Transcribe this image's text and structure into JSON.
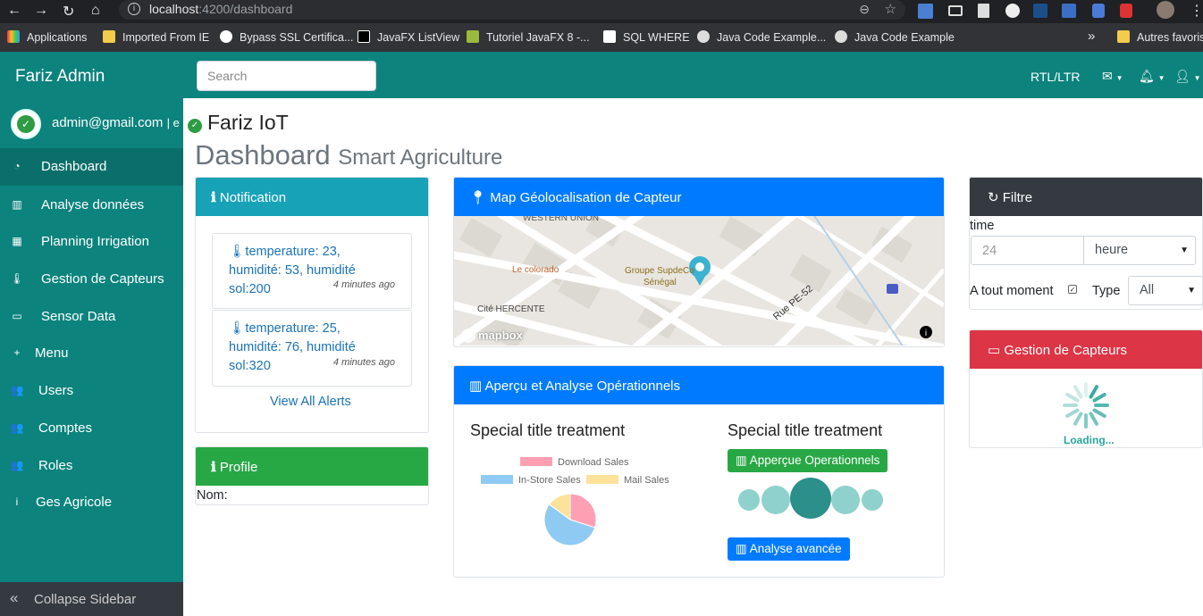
{
  "browser": {
    "url_host": "localhost",
    "url_path": ":4200/dashboard",
    "bookmarks": [
      "Applications",
      "Imported From IE",
      "Bypass SSL Certifica...",
      "JavaFX ListView",
      "Tutoriel JavaFX 8 -...",
      "SQL WHERE",
      "Java Code Example...",
      "Java Code Example",
      "»",
      "Autres favoris"
    ]
  },
  "topnav": {
    "brand": "Fariz Admin",
    "search_placeholder": "Search",
    "rtl_label": "RTL/LTR"
  },
  "sidebar": {
    "email": "admin@gmail.com",
    "email_suffix": "| e",
    "items": [
      {
        "label": "Dashboard",
        "icon": "dashboard-icon",
        "glyph": "◔"
      },
      {
        "label": "Analyse données",
        "icon": "bar-chart-icon",
        "glyph": "▥"
      },
      {
        "label": "Planning Irrigation",
        "icon": "table-icon",
        "glyph": "▦"
      },
      {
        "label": "Gestion de Capteurs",
        "icon": "thermometer-icon",
        "glyph": "🌡"
      },
      {
        "label": "Sensor Data",
        "icon": "laptop-icon",
        "glyph": "▭"
      },
      {
        "label": "Menu",
        "icon": "plus-icon",
        "glyph": "+"
      },
      {
        "label": "Users",
        "icon": "users-icon",
        "glyph": "👥"
      },
      {
        "label": "Comptes",
        "icon": "users-icon",
        "glyph": "👥"
      },
      {
        "label": "Roles",
        "icon": "users-icon",
        "glyph": "👥"
      },
      {
        "label": "Ges Agricole",
        "icon": "info-icon",
        "glyph": "i"
      }
    ],
    "collapse_label": "Collapse Sidebar"
  },
  "header": {
    "title": "Fariz IoT",
    "dashboard": "Dashboard",
    "subtitle": "Smart Agriculture"
  },
  "notification": {
    "title": "Notification",
    "items": [
      {
        "l1": "temperature: 23,",
        "l2": "humidité: 53, humidité",
        "l3": "sol:200",
        "time": "4 minutes ago"
      },
      {
        "l1": "temperature: 25,",
        "l2": "humidité: 76, humidité",
        "l3": "sol:320",
        "time": "4 minutes ago"
      }
    ],
    "view_all": "View All Alerts"
  },
  "profile": {
    "title": "Profile",
    "nom_label": "Nom:"
  },
  "map": {
    "title": "Map Géolocalisation de Capteur",
    "labels": [
      "WESTERN UNION",
      "Le colorado",
      "Groupe SupdeCo",
      "Sénégal",
      "Cité HERCENTE",
      "Rue PE-52",
      "mapbox"
    ]
  },
  "apercu": {
    "title": "Aperçu et Analyse Opérationnels",
    "left_title": "Special title treatment",
    "right_title": "Special title treatment",
    "btn_operationnels": "Apperçue Operationnels",
    "btn_avancee": "Analyse avancée"
  },
  "chart_data": {
    "type": "pie",
    "categories": [
      "Download Sales",
      "In-Store Sales",
      "Mail Sales"
    ],
    "values": [
      30,
      55,
      15
    ],
    "colors": [
      "#ff9fb3",
      "#8fcaf2",
      "#ffe29a"
    ]
  },
  "filtre": {
    "title": "Filtre",
    "time_label": "time",
    "time_value": "24",
    "unit_select": "heure",
    "a_tout_moment": "A tout moment",
    "type_label": "Type",
    "type_select": "All"
  },
  "gestion": {
    "title": "Gestion de Capteurs",
    "loading": "Loading..."
  },
  "colors": {
    "teal": "#0c837d",
    "info": "#17a2b8",
    "primary": "#007bff",
    "success": "#28a745",
    "danger": "#dc3545",
    "dark": "#343a40"
  }
}
